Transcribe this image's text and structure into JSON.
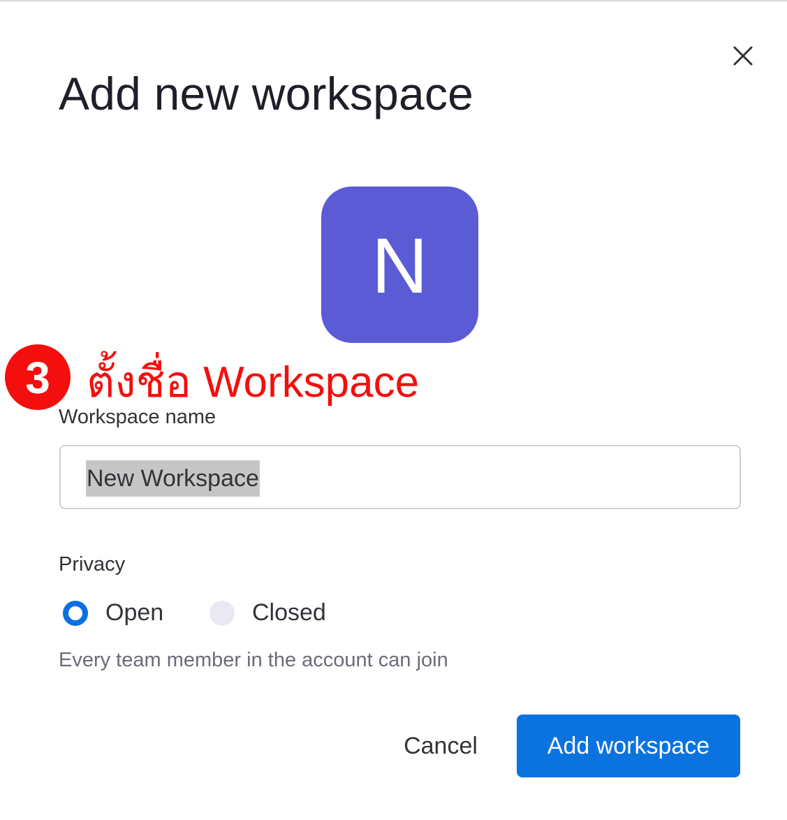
{
  "dialog": {
    "title": "Add new workspace",
    "avatar_letter": "N",
    "close_icon": "close-icon"
  },
  "annotation": {
    "step_number": "3",
    "text": "ตั้งชื่อ Workspace",
    "color": "#f40e0e"
  },
  "form": {
    "name_label": "Workspace name",
    "name_value": "New Workspace",
    "privacy_label": "Privacy",
    "privacy_options": [
      {
        "label": "Open",
        "selected": true
      },
      {
        "label": "Closed",
        "selected": false
      }
    ],
    "privacy_help": "Every team member in the account can join"
  },
  "actions": {
    "cancel_label": "Cancel",
    "submit_label": "Add workspace"
  },
  "colors": {
    "avatar": "#5b5bd6",
    "primary": "#0b73e0"
  }
}
